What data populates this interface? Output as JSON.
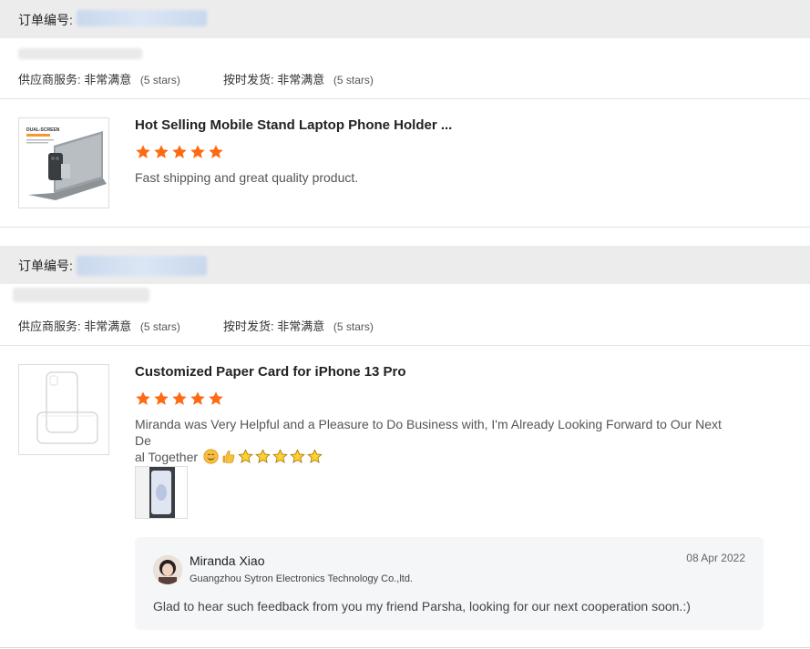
{
  "order_label": "订单编号:",
  "orders": [
    {
      "supplier_service_label": "供应商服务:",
      "supplier_service_value": "非常满意",
      "supplier_service_stars": "(5 stars)",
      "shipping_label": "按时发货:",
      "shipping_value": "非常满意",
      "shipping_stars": "(5 stars)",
      "product_title": "Hot Selling Mobile Stand Laptop Phone Holder ...",
      "rating": 5,
      "review": "Fast shipping and great quality product.",
      "thumb_caption": "DUAL-SCREEN"
    },
    {
      "supplier_service_label": "供应商服务:",
      "supplier_service_value": "非常满意",
      "supplier_service_stars": "(5 stars)",
      "shipping_label": "按时发货:",
      "shipping_value": "非常满意",
      "shipping_stars": "(5 stars)",
      "product_title": "Customized Paper Card for iPhone 13 Pro",
      "rating": 5,
      "review_line1": "Miranda was Very Helpful and a Pleasure to Do Business with, I'm Already Looking Forward to Our Next De",
      "review_line2": "al Together",
      "reply": {
        "name": "Miranda Xiao",
        "company": "Guangzhou Sytron Electronics Technology Co.,ltd.",
        "date": "08 Apr 2022",
        "text": "Glad to hear such feedback from you my friend Parsha, looking for our next cooperation soon.:)"
      }
    }
  ],
  "colors": {
    "star": "#ff6a14",
    "header_bg": "#ececec",
    "reply_bg": "#f5f6f7"
  },
  "icons": {
    "rating_star": "star-icon",
    "emoji_face": "smiling-face-icon",
    "emoji_thumb": "thumbs-up-icon",
    "emoji_star": "yellow-star-icon"
  }
}
